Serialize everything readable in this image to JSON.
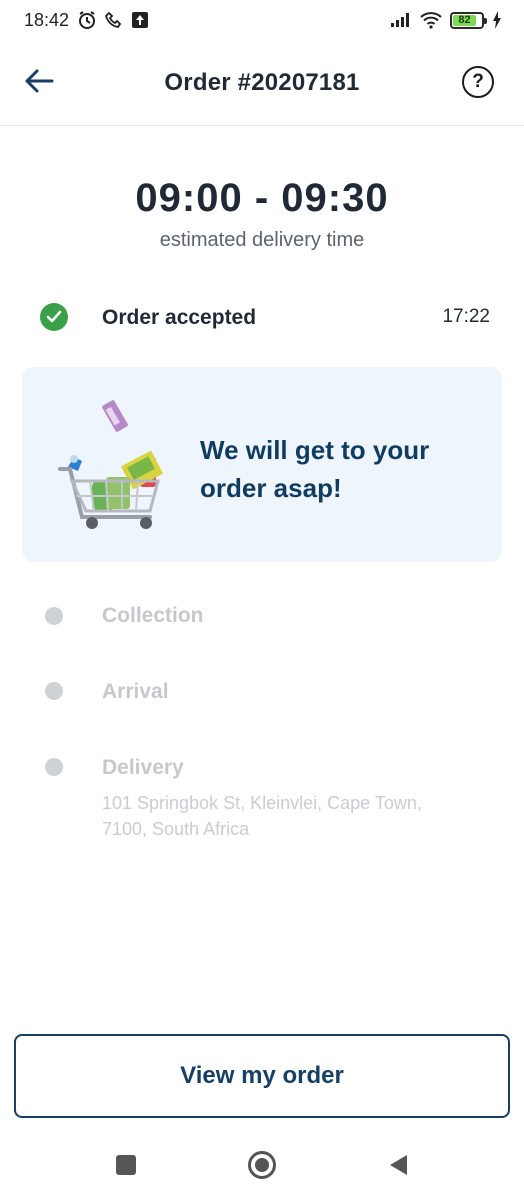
{
  "status_bar": {
    "time": "18:42",
    "battery_level": "82",
    "icons": [
      "alarm-icon",
      "phone-call-icon",
      "upload-icon",
      "signal-icon",
      "wifi-icon",
      "battery-icon",
      "charging-icon"
    ]
  },
  "header": {
    "title": "Order #20207181",
    "back_icon": "arrow-left-icon",
    "help_icon": "question-circle-icon",
    "help_glyph": "?"
  },
  "eta": {
    "time_range": "09:00 - 09:30",
    "caption": "estimated delivery time"
  },
  "steps": [
    {
      "label": "Order accepted",
      "time": "17:22",
      "state": "done"
    },
    {
      "label": "Collection",
      "state": "pending"
    },
    {
      "label": "Arrival",
      "state": "pending"
    },
    {
      "label": "Delivery",
      "state": "pending",
      "address": "101 Springbok St, Kleinvlei, Cape Town, 7100, South Africa"
    }
  ],
  "info_card": {
    "message": "We will get to your order asap!",
    "illustration": "shopping-cart-icon"
  },
  "actions": {
    "view_order_label": "View my order"
  },
  "nav": {
    "icons": [
      "recents-square-icon",
      "home-circle-icon",
      "back-triangle-icon"
    ]
  },
  "colors": {
    "primary": "#173f63",
    "success": "#3aa14a",
    "card_bg": "#eff5fd",
    "inactive": "#c5c9cd"
  }
}
